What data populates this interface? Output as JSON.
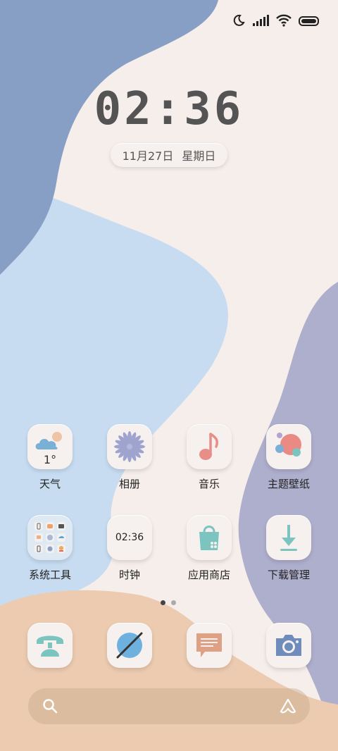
{
  "status_bar": {
    "icons": [
      "moon-icon",
      "signal-icon",
      "wifi-icon",
      "battery-icon"
    ]
  },
  "lock": {
    "time": "02:36",
    "date": "11月27日",
    "weekday": "星期日"
  },
  "apps_row1": [
    {
      "label": "天气",
      "icon": "weather-icon",
      "temp": "1°"
    },
    {
      "label": "相册",
      "icon": "gallery-icon"
    },
    {
      "label": "音乐",
      "icon": "music-icon"
    },
    {
      "label": "主题壁纸",
      "icon": "themes-icon"
    }
  ],
  "apps_row2": [
    {
      "label": "系统工具",
      "icon": "system-tools-folder-icon"
    },
    {
      "label": "时钟",
      "icon": "clock-icon",
      "time": "02:36"
    },
    {
      "label": "应用商店",
      "icon": "app-store-icon"
    },
    {
      "label": "下载管理",
      "icon": "download-icon"
    }
  ],
  "dock": [
    {
      "icon": "phone-icon"
    },
    {
      "icon": "browser-icon"
    },
    {
      "icon": "messages-icon"
    },
    {
      "icon": "camera-icon"
    }
  ],
  "page_indicator": {
    "pages": 2,
    "current": 1
  },
  "colors": {
    "bg_cream": "#f5eeeb",
    "blue_dark": "#879fc4",
    "blue_light": "#c7dcf1",
    "purple": "#aeaecd",
    "peach": "#eccbb0"
  }
}
